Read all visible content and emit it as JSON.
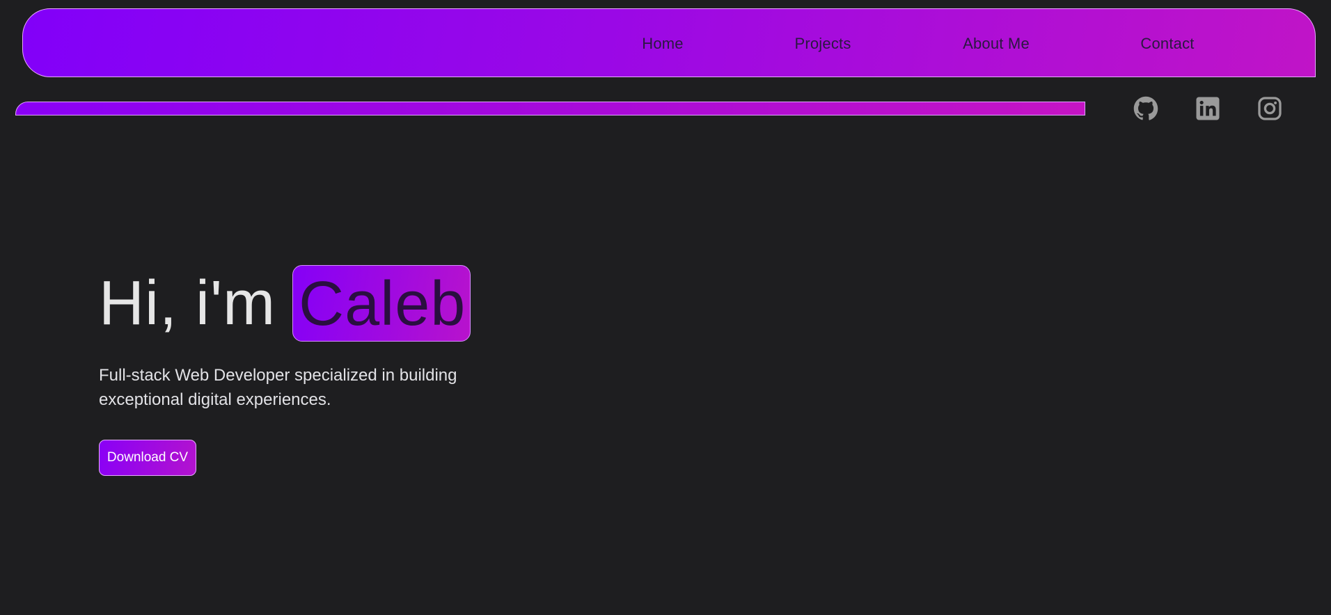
{
  "header": {
    "nav": [
      {
        "label": "Home"
      },
      {
        "label": "Projects"
      },
      {
        "label": "About Me"
      },
      {
        "label": "Contact"
      }
    ]
  },
  "social": [
    {
      "icon": "github-icon"
    },
    {
      "icon": "linkedin-icon"
    },
    {
      "icon": "instagram-icon"
    }
  ],
  "hero": {
    "greeting": "Hi, i'm",
    "name": "Caleb",
    "subtitle": "Full-stack Web Developer specialized in building exceptional digital experiences.",
    "cta_label": "Download CV"
  },
  "colors": {
    "background": "#1e1e20",
    "accent_start": "#8200f9",
    "accent_end": "#c514c4",
    "icon": "#9a9a9a"
  }
}
